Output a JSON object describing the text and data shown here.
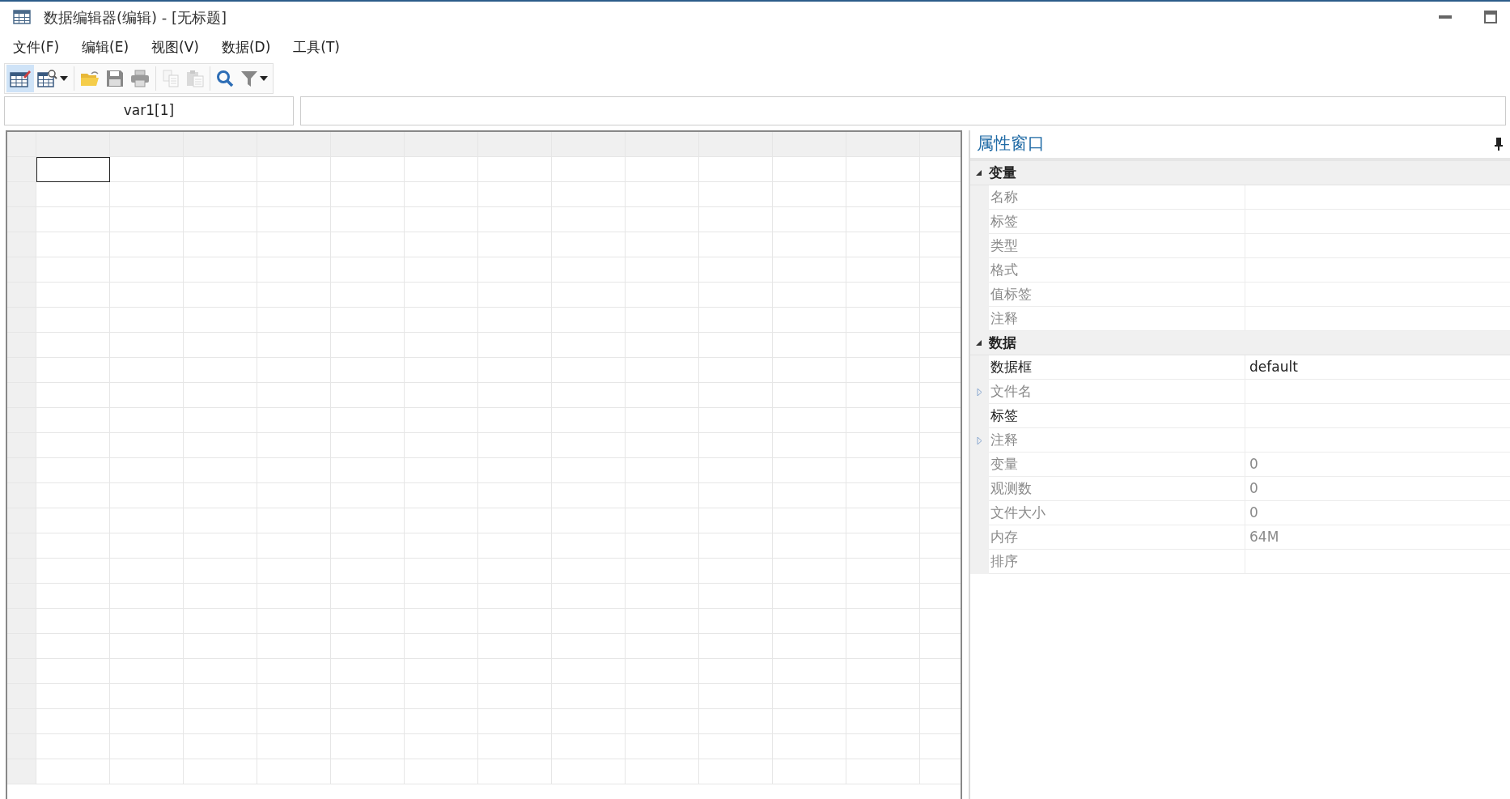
{
  "window": {
    "title": "数据编辑器(编辑) - [无标题]"
  },
  "menu": [
    {
      "label": "文件(F)"
    },
    {
      "label": "编辑(E)"
    },
    {
      "label": "视图(V)"
    },
    {
      "label": "数据(D)"
    },
    {
      "label": "工具(T)"
    }
  ],
  "toolbar": [
    {
      "kind": "edit-grid",
      "selected": true,
      "disabled": false
    },
    {
      "kind": "browse-grid",
      "selected": false,
      "disabled": false
    },
    {
      "kind": "sep"
    },
    {
      "kind": "open",
      "selected": false,
      "disabled": false
    },
    {
      "kind": "save",
      "selected": false,
      "disabled": false
    },
    {
      "kind": "print",
      "selected": false,
      "disabled": false
    },
    {
      "kind": "sep"
    },
    {
      "kind": "copy",
      "selected": false,
      "disabled": true
    },
    {
      "kind": "paste",
      "selected": false,
      "disabled": true
    },
    {
      "kind": "sep"
    },
    {
      "kind": "search",
      "selected": false,
      "disabled": false
    },
    {
      "kind": "filter",
      "selected": false,
      "disabled": false
    }
  ],
  "cell_reference": "var1[1]",
  "properties": {
    "title": "属性窗口",
    "groups": [
      {
        "label": "变量",
        "expanded": true,
        "items": [
          {
            "label": "名称",
            "disabled": true,
            "expandable": false
          },
          {
            "label": "标签",
            "disabled": true,
            "expandable": false
          },
          {
            "label": "类型",
            "disabled": true,
            "expandable": false
          },
          {
            "label": "格式",
            "disabled": true,
            "expandable": false
          },
          {
            "label": "值标签",
            "disabled": true,
            "expandable": false
          },
          {
            "label": "注释",
            "disabled": true,
            "expandable": false
          }
        ]
      },
      {
        "label": "数据",
        "expanded": true,
        "items": [
          {
            "label": "数据框",
            "value": "default",
            "disabled": false,
            "expandable": false
          },
          {
            "label": "文件名",
            "disabled": true,
            "expandable": true
          },
          {
            "label": "标签",
            "disabled": false,
            "expandable": false
          },
          {
            "label": "注释",
            "disabled": true,
            "expandable": true
          },
          {
            "label": "变量",
            "value": "0",
            "disabled": true,
            "expandable": false
          },
          {
            "label": "观测数",
            "value": "0",
            "disabled": true,
            "expandable": false
          },
          {
            "label": "文件大小",
            "value": "0",
            "disabled": true,
            "expandable": false
          },
          {
            "label": "内存",
            "value": "64M",
            "disabled": true,
            "expandable": false
          },
          {
            "label": "排序",
            "disabled": true,
            "expandable": false
          }
        ]
      }
    ]
  }
}
